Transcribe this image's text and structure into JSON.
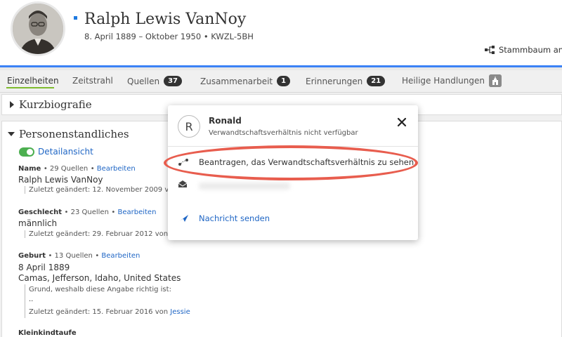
{
  "header": {
    "name": "Ralph Lewis VanNoy",
    "meta": "8. April 1889 – Oktober 1950 • KWZL-5BH",
    "tree_link": "Stammbaum an"
  },
  "tabs": [
    {
      "label": "Einzelheiten",
      "badge": null
    },
    {
      "label": "Zeitstrahl",
      "badge": null
    },
    {
      "label": "Quellen",
      "badge": "37"
    },
    {
      "label": "Zusammenarbeit",
      "badge": "1"
    },
    {
      "label": "Erinnerungen",
      "badge": "21"
    },
    {
      "label": "Heilige Handlungen",
      "badge": null
    }
  ],
  "sections": {
    "bio_title": "Kurzbiografie",
    "vitals_title": "Personenstandliches",
    "detail_toggle": "Detailansicht"
  },
  "facts": {
    "name": {
      "label": "Name",
      "sources": "29 Quellen",
      "edit": "Bearbeiten",
      "value": "Ralph Lewis VanNoy",
      "changed": "Zuletzt geändert: 12. November 2009 vo"
    },
    "gender": {
      "label": "Geschlecht",
      "sources": "23 Quellen",
      "edit": "Bearbeiten",
      "value": "männlich",
      "changed": "Zuletzt geändert: 29. Februar 2012 von"
    },
    "birth": {
      "label": "Geburt",
      "sources": "13 Quellen",
      "edit": "Bearbeiten",
      "date": "8 April 1889",
      "place": "Camas, Jefferson, Idaho, United States",
      "reason_label": "Grund, weshalb diese Angabe richtig ist:",
      "reason_text": "..",
      "changed": "Zuletzt geändert: 15. Februar 2016 von",
      "changed_by": "Jessie"
    },
    "christening": {
      "label": "Kleinkindtaufe"
    }
  },
  "popup": {
    "avatar_letter": "R",
    "name": "Ronald",
    "status": "Verwandtschaftsverhältnis nicht verfügbar",
    "request": "Beantragen, das Verwandtschaftsverhältnis zu sehen",
    "send_message": "Nachricht senden"
  },
  "colors": {
    "accent_blue": "#3b82f6",
    "link_blue": "#1f66c5",
    "active_tab_underline": "#7fbc2e",
    "toggle_green": "#4caf50",
    "highlight_red": "#e85d4e"
  }
}
